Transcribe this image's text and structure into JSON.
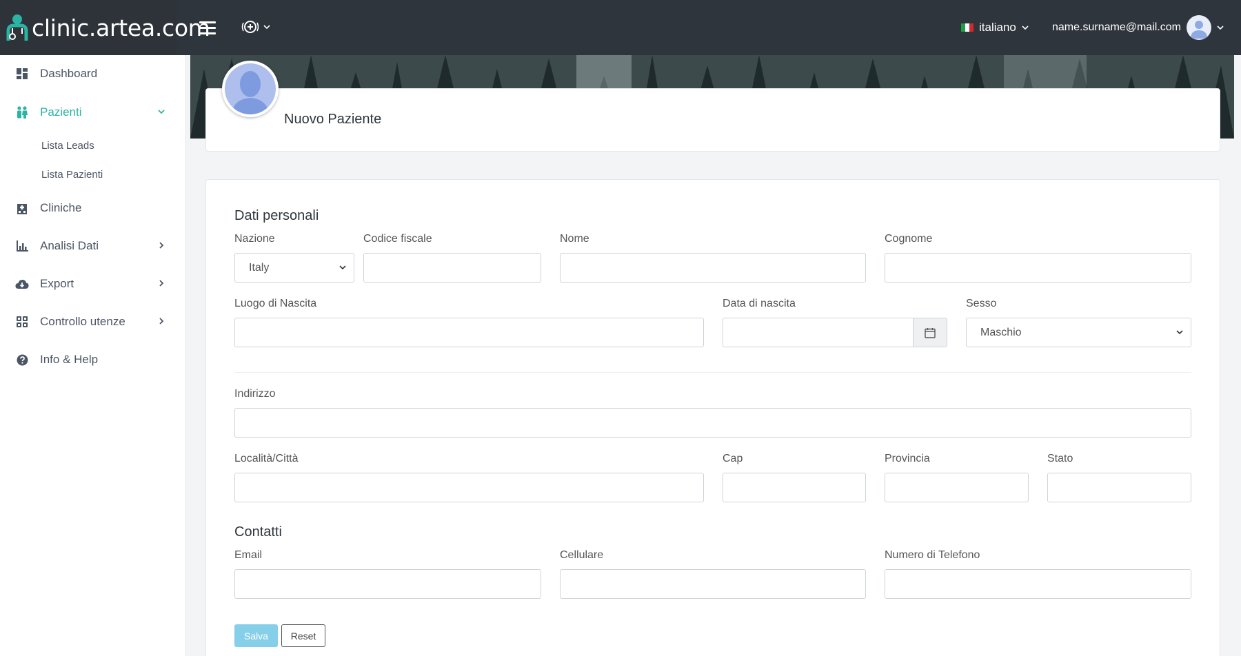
{
  "header": {
    "brand": "clinic.artea.com",
    "language": "italiano",
    "user_email": "name.surname@mail.com"
  },
  "sidebar": {
    "items": [
      {
        "label": "Dashboard",
        "icon": "dashboard-icon"
      },
      {
        "label": "Pazienti",
        "icon": "patients-icon",
        "active": true,
        "sub": [
          "Lista Leads",
          "Lista Pazienti"
        ]
      },
      {
        "label": "Cliniche",
        "icon": "hospital-icon"
      },
      {
        "label": "Analisi Dati",
        "icon": "chart-icon"
      },
      {
        "label": "Export",
        "icon": "cloud-download-icon"
      },
      {
        "label": "Controllo utenze",
        "icon": "grid-icon"
      },
      {
        "label": "Info & Help",
        "icon": "help-icon"
      }
    ]
  },
  "page": {
    "title": "Nuovo Paziente"
  },
  "form": {
    "personal_title": "Dati personali",
    "contacts_title": "Contatti",
    "nazione_label": "Nazione",
    "nazione_value": "Italy",
    "codice_fiscale_label": "Codice fiscale",
    "nome_label": "Nome",
    "cognome_label": "Cognome",
    "luogo_nascita_label": "Luogo di Nascita",
    "data_nascita_label": "Data di nascita",
    "sesso_label": "Sesso",
    "sesso_value": "Maschio",
    "indirizzo_label": "Indirizzo",
    "citta_label": "Località/Città",
    "cap_label": "Cap",
    "provincia_label": "Provincia",
    "stato_label": "Stato",
    "email_label": "Email",
    "cellulare_label": "Cellulare",
    "telefono_label": "Numero di Telefono",
    "save_label": "Salva",
    "reset_label": "Reset"
  },
  "colors": {
    "topbar": "#2f353c",
    "accent": "#2bb3a3",
    "save_button": "#86cfe8"
  }
}
